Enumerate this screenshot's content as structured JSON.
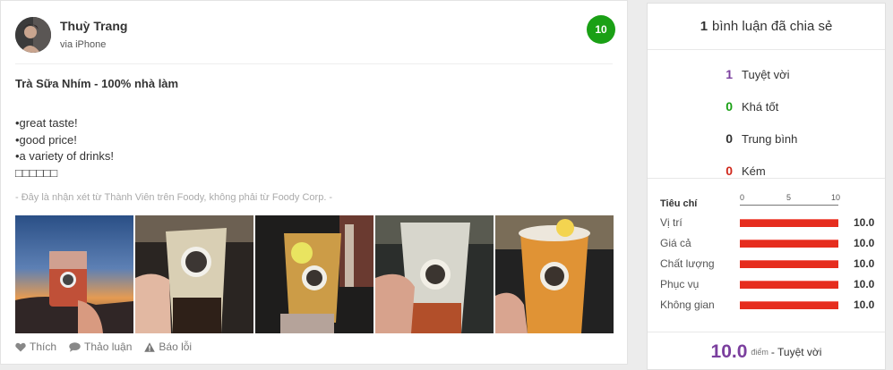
{
  "review": {
    "user_name": "Thuỳ Trang",
    "device": "via iPhone",
    "score": "10",
    "title": "Trà Sữa Nhím - 100% nhà làm",
    "body_lines": [
      "•great taste!",
      "•good price!",
      "•a variety of drinks!",
      "□□□□□□"
    ],
    "disclaimer": "- Đây là nhận xét từ Thành Viên trên Foody, không phải từ Foody Corp. -",
    "photos": [
      "sunset-drink-photo",
      "milk-tea-photo",
      "lemon-tea-photo",
      "iced-tea-photo",
      "fruit-tea-photo"
    ],
    "actions": {
      "like": "Thích",
      "discuss": "Thảo luận",
      "report": "Báo lỗi"
    }
  },
  "panel": {
    "count": "1",
    "count_label": "bình luận đã chia sẻ",
    "tally": [
      {
        "num": "1",
        "label": "Tuyệt vời",
        "color": "#7b3f9e"
      },
      {
        "num": "0",
        "label": "Khá tốt",
        "color": "#1aa015"
      },
      {
        "num": "0",
        "label": "Trung bình",
        "color": "#333333"
      },
      {
        "num": "0",
        "label": "Kém",
        "color": "#d0281c"
      }
    ],
    "criteria_label": "Tiêu chí",
    "scale": [
      "0",
      "5",
      "10"
    ],
    "criteria": [
      {
        "name": "Vị trí",
        "value": "10.0",
        "fill": 1.0
      },
      {
        "name": "Giá cả",
        "value": "10.0",
        "fill": 1.0
      },
      {
        "name": "Chất lượng",
        "value": "10.0",
        "fill": 1.0
      },
      {
        "name": "Phục vụ",
        "value": "10.0",
        "fill": 1.0
      },
      {
        "name": "Không gian",
        "value": "10.0",
        "fill": 1.0
      }
    ],
    "total_score": "10.0",
    "total_unit": "điểm",
    "total_label": "- Tuyệt vời"
  },
  "colors": {
    "badge": "#1aa015",
    "bar": "#e62d1e",
    "total": "#7b3f9e"
  }
}
